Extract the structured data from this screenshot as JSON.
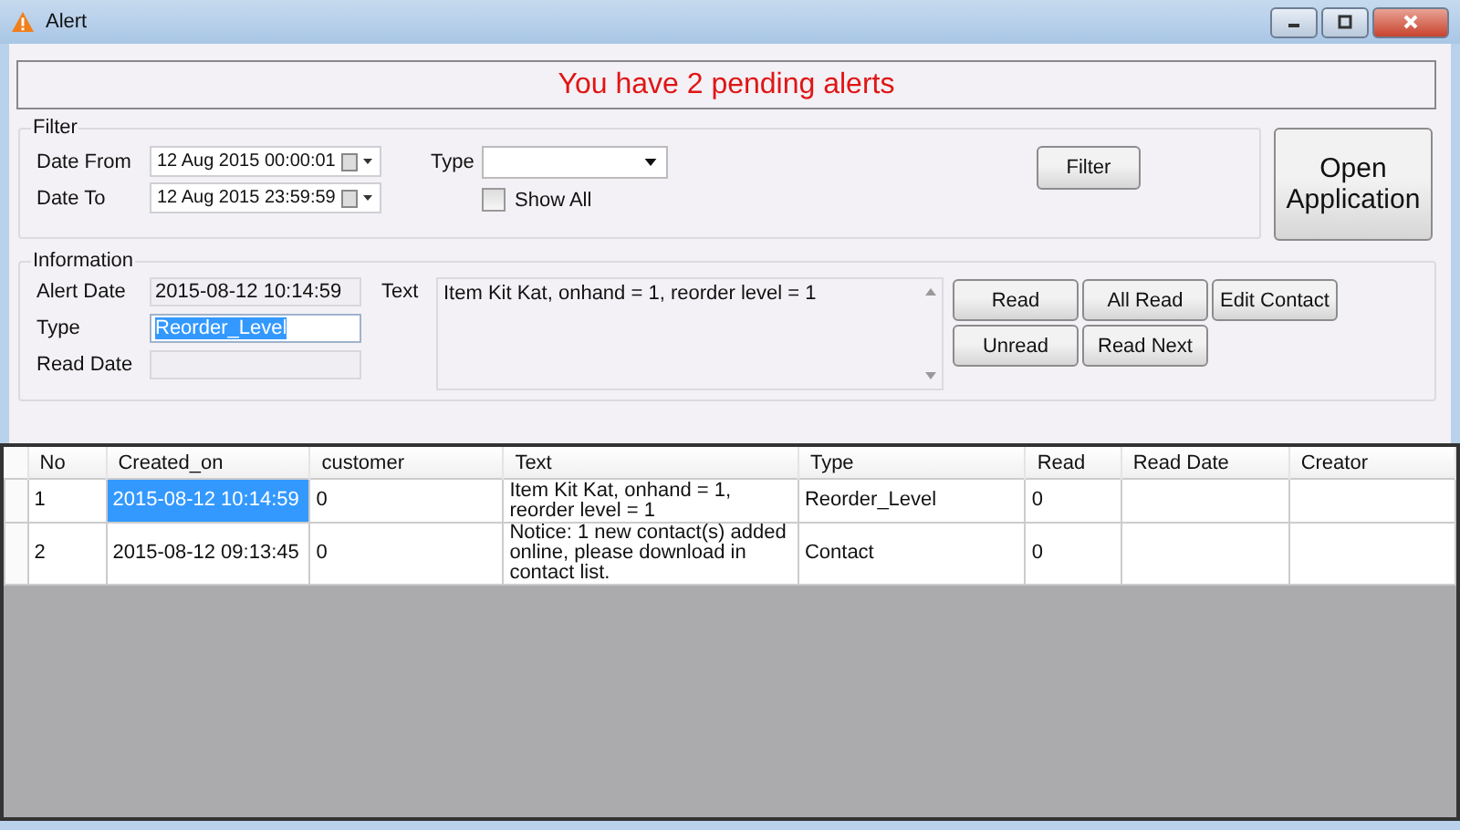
{
  "window": {
    "title": "Alert"
  },
  "banner": {
    "text": "You have 2 pending alerts"
  },
  "filter": {
    "title": "Filter",
    "date_from": {
      "label": "Date From",
      "value": "12 Aug  2015 00:00:01"
    },
    "date_to": {
      "label": "Date To",
      "value": "12 Aug  2015 23:59:59"
    },
    "type": {
      "label": "Type"
    },
    "show_all": {
      "label": "Show All",
      "checked": false
    },
    "button": "Filter"
  },
  "open_application": "Open Application",
  "information": {
    "title": "Information",
    "fields": [
      {
        "label": "Alert Date",
        "value": "2015-08-12 10:14:59"
      },
      {
        "label": "Type",
        "value": "Reorder_Level",
        "text_selected": true
      },
      {
        "label": "Read Date"
      }
    ],
    "text": {
      "label": "Text",
      "value": "Item Kit Kat, onhand = 1, reorder level = 1"
    },
    "buttons": [
      [
        "Read",
        "All Read",
        "Edit Contact"
      ],
      [
        "Unread",
        "Read Next"
      ]
    ]
  },
  "table": {
    "columns": [
      "No",
      "Created_on",
      "customer",
      "Text",
      "Type",
      "Read",
      "Read Date",
      "Creator"
    ],
    "rows": [
      {
        "cells": [
          "1",
          "2015-08-12 10:14:59",
          "0",
          "Item Kit Kat, onhand = 1, reorder level = 1",
          "Reorder_Level",
          "0",
          "",
          ""
        ],
        "selected": true
      },
      {
        "cells": [
          "2",
          "2015-08-12 09:13:45",
          "0",
          "Notice: 1 new contact(s) added online, please download in contact list.",
          "Contact",
          "0",
          "",
          ""
        ],
        "selected": false
      }
    ]
  }
}
